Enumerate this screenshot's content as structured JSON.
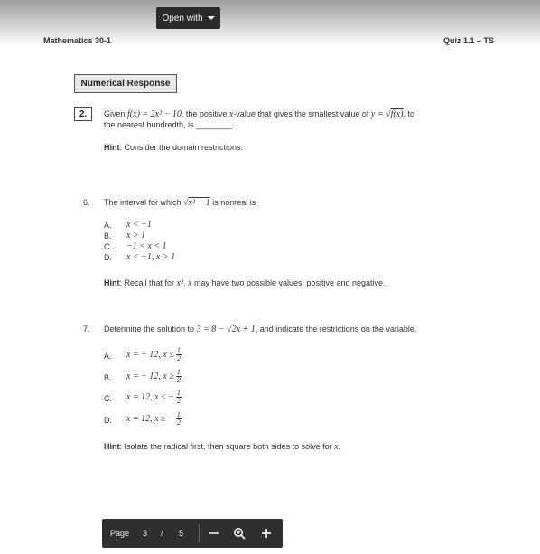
{
  "viewer": {
    "open_with_label": "Open with",
    "toolbar": {
      "page_label": "Page",
      "current_page": "3",
      "separator": "/",
      "total_pages": "5"
    }
  },
  "document": {
    "header_left": "Mathematics 30-1",
    "header_right": "Quiz 1.1 – TS",
    "section_title": "Numerical Response",
    "q2": {
      "number": "2.",
      "text_a": "Given ",
      "fx": "f(x) = 2x² − 10",
      "text_b": ", the positive ",
      "x": "x",
      "text_c": "-value that gives the smallest value of ",
      "y_eq": "y = ",
      "rad": "f(x)",
      "text_d": ", to",
      "line2": "the nearest hundredth, is ________.",
      "hint_label": "Hint",
      "hint_text": ": Consider the domain restrictions."
    },
    "q6": {
      "number": "6.",
      "text_a": "The interval for which ",
      "rad": "x² − 1",
      "text_b": " is nonreal is",
      "options": [
        {
          "letter": "A.",
          "math": "x < −1"
        },
        {
          "letter": "B.",
          "math": "x > 1"
        },
        {
          "letter": "C.",
          "math": "−1 < x < 1"
        },
        {
          "letter": "D.",
          "math": "x < −1, x > 1"
        }
      ],
      "hint_label": "Hint",
      "hint_a": ": Recall that for ",
      "hint_math1": "x²",
      "hint_b": ", ",
      "hint_math2": "x",
      "hint_c": " may have two possible values, positive and negative."
    },
    "q7": {
      "number": "7.",
      "text_a": "Determine the solution to ",
      "eq": "3 = 8 − ",
      "rad": "2x + 1",
      "text_b": ", and indicate the restrictions on the variable.",
      "options": [
        {
          "letter": "A.",
          "math": "x = − 12, x ≤",
          "num": "1",
          "den": "2"
        },
        {
          "letter": "B.",
          "math": "x = − 12, x ≥",
          "num": "1",
          "den": "2"
        },
        {
          "letter": "C.",
          "math": "x = 12, x ≤ −",
          "num": "1",
          "den": "2"
        },
        {
          "letter": "D.",
          "math": "x = 12, x ≥ −",
          "num": "1",
          "den": "2"
        }
      ],
      "hint_label": "Hint",
      "hint_a": ": Isolate the radical first, then square both sides to solve for ",
      "hint_math": "x",
      "hint_b": "."
    }
  }
}
